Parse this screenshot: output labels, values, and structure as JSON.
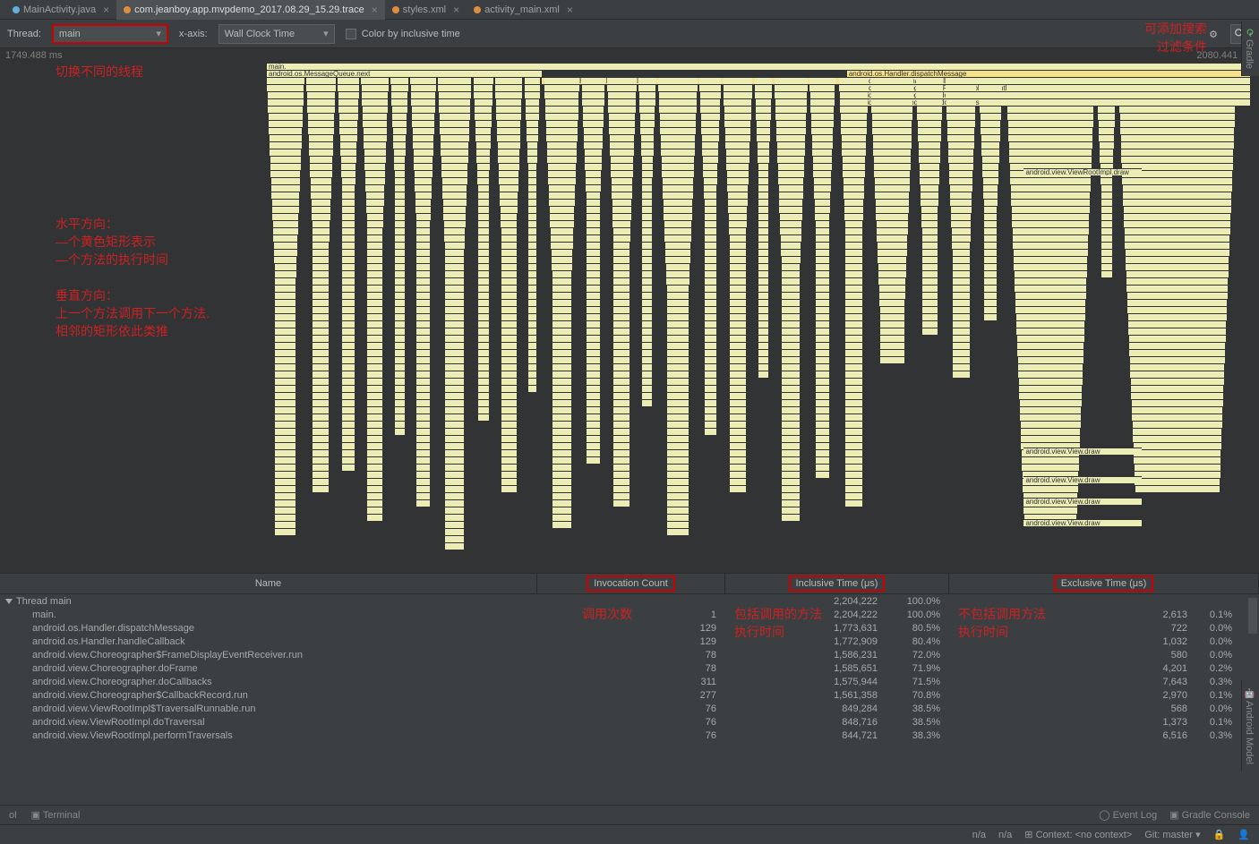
{
  "tabs": [
    {
      "label": "MainActivity.java",
      "active": false,
      "icon": "c"
    },
    {
      "label": "com.jeanboy.app.mvpdemo_2017.08.29_15.29.trace",
      "active": true,
      "icon": "o"
    },
    {
      "label": "styles.xml",
      "active": false,
      "icon": "o"
    },
    {
      "label": "activity_main.xml",
      "active": false,
      "icon": "o"
    }
  ],
  "toolbar": {
    "thread_label": "Thread:",
    "thread_value": "main",
    "xaxis_label": "x-axis:",
    "xaxis_value": "Wall Clock Time",
    "color_label": "Color by inclusive time"
  },
  "ruler": {
    "left": "1749.488 ms",
    "right": "2080.441 ms"
  },
  "flame_labels": {
    "r0": "main.",
    "r1": "android.os.MessageQueue.next",
    "r2": "android.os.Handler.dispatchMessage",
    "r3": "android.os.Handler.handleCallback",
    "r4": "android.view.Choreographer$FrameDisplayEventReceiver.run",
    "r5": "android.view.Choreographer.doFrame",
    "r6": "android.view.Choreographer.doCallbacks",
    "r2b": "android.os.Handler.handleCallback",
    "vd": "android.view.ViewRootImpl.draw",
    "vv": "android.view.View.draw"
  },
  "annotations": {
    "a1": "切换不同的线程",
    "a2": "水平方向：\n—个黄色矩形表示\n—个方法的执行时间",
    "a3": "垂直方向：\n上一个方法调用下一个方法.\n相邻的矩形依此类推",
    "a4": "可添加搜索\n过滤条件",
    "a5": "调用次数",
    "a6": "包括调用的方法\n执行时间",
    "a7": "不包括调用方法\n执行时间"
  },
  "table_headers": {
    "name": "Name",
    "inv": "Invocation Count",
    "inc": "Inclusive Time (μs)",
    "exc": "Exclusive Time (μs)"
  },
  "table_rows": [
    {
      "name": "Thread main",
      "inv": "",
      "inc": "2,204,222",
      "incp": "100.0%",
      "exc": "",
      "excp": "",
      "indent": 0,
      "tri": true
    },
    {
      "name": "main.",
      "inv": "1",
      "inc": "2,204,222",
      "incp": "100.0%",
      "exc": "2,613",
      "excp": "0.1%",
      "indent": 1
    },
    {
      "name": "android.os.Handler.dispatchMessage",
      "inv": "129",
      "inc": "1,773,631",
      "incp": "80.5%",
      "exc": "722",
      "excp": "0.0%",
      "indent": 1
    },
    {
      "name": "android.os.Handler.handleCallback",
      "inv": "129",
      "inc": "1,772,909",
      "incp": "80.4%",
      "exc": "1,032",
      "excp": "0.0%",
      "indent": 1
    },
    {
      "name": "android.view.Choreographer$FrameDisplayEventReceiver.run",
      "inv": "78",
      "inc": "1,586,231",
      "incp": "72.0%",
      "exc": "580",
      "excp": "0.0%",
      "indent": 1
    },
    {
      "name": "android.view.Choreographer.doFrame",
      "inv": "78",
      "inc": "1,585,651",
      "incp": "71.9%",
      "exc": "4,201",
      "excp": "0.2%",
      "indent": 1
    },
    {
      "name": "android.view.Choreographer.doCallbacks",
      "inv": "311",
      "inc": "1,575,944",
      "incp": "71.5%",
      "exc": "7,643",
      "excp": "0.3%",
      "indent": 1
    },
    {
      "name": "android.view.Choreographer$CallbackRecord.run",
      "inv": "277",
      "inc": "1,561,358",
      "incp": "70.8%",
      "exc": "2,970",
      "excp": "0.1%",
      "indent": 1
    },
    {
      "name": "android.view.ViewRootImpl$TraversalRunnable.run",
      "inv": "76",
      "inc": "849,284",
      "incp": "38.5%",
      "exc": "568",
      "excp": "0.0%",
      "indent": 1
    },
    {
      "name": "android.view.ViewRootImpl.doTraversal",
      "inv": "76",
      "inc": "848,716",
      "incp": "38.5%",
      "exc": "1,373",
      "excp": "0.1%",
      "indent": 1
    },
    {
      "name": "android.view.ViewRootImpl.performTraversals",
      "inv": "76",
      "inc": "844,721",
      "incp": "38.3%",
      "exc": "6,516",
      "excp": "0.3%",
      "indent": 1
    }
  ],
  "status": {
    "terminal": "Terminal",
    "eventlog": "Event Log",
    "gradle": "Gradle Console",
    "ol": "ol"
  },
  "bottom": {
    "context": "Context: <no context>",
    "git": "Git: master",
    "na": "n/a"
  },
  "side": {
    "gradle": "Gradle",
    "model": "Android Model"
  }
}
